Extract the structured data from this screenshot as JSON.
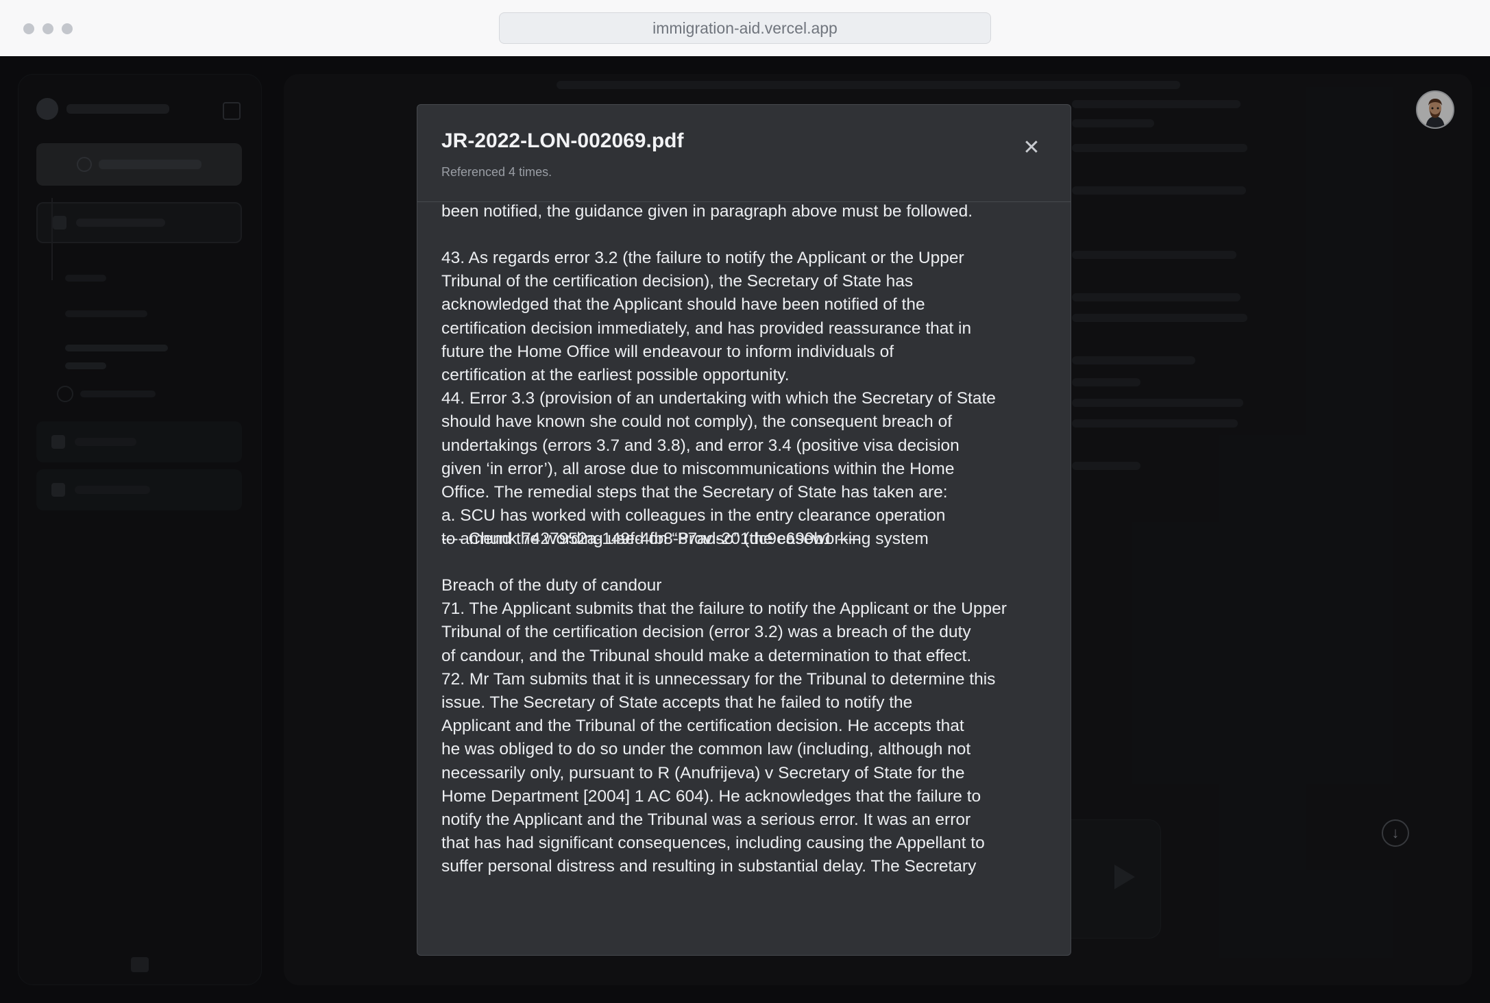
{
  "browser": {
    "url": "immigration-aid.vercel.app"
  },
  "modal": {
    "title": "JR-2022-LON-002069.pdf",
    "subtitle": "Referenced 4 times.",
    "close_icon": "close-icon",
    "paragraphs": [
      "been notified, the guidance given in paragraph above must be followed.",
      "43. As regards error 3.2 (the failure to notify the Applicant or the Upper\nTribunal of the certification decision), the Secretary of State has\nacknowledged that the Applicant should have been notified of the\ncertification decision immediately, and has provided reassurance that in\nfuture the Home Office will endeavour to inform individuals of\ncertification at the earliest possible opportunity.\n44. Error 3.3 (provision of an undertaking with which the Secretary of State\nshould have known she could not comply), the consequent breach of\nundertakings (errors 3.7 and 3.8), and error 3.4 (positive visa decision\ngiven ‘in error’), all arose due to miscommunications within the Home\nOffice. The remedial steps that the Secretary of State has taken are:\na. SCU has worked with colleagues in the entry clearance operation\nto amend the wording used on “Proviso” (the caseworking system",
      "---- Chunk 7427952a-149f-4fb8-87ad-201dc9e690b1 ----",
      "Breach of the duty of candour\n71. The Applicant submits that the failure to notify the Applicant or the Upper\nTribunal of the certification decision (error 3.2) was a breach of the duty\nof candour, and the Tribunal should make a determination to that effect.\n72. Mr Tam submits that it is unnecessary for the Tribunal to determine this\nissue. The Secretary of State accepts that he failed to notify the\nApplicant and the Tribunal of the certification decision. He accepts that\nhe was obliged to do so under the common law (including, although not\nnecessarily only, pursuant to R (Anufrijeva) v Secretary of State for the\nHome Department [2004] 1 AC 604). He acknowledges that the failure to\nnotify the Applicant and the Tribunal was a serious error. It was an error\nthat has had significant consequences, including causing the Appellant to\nsuffer personal distress and resulting in substantial delay. The Secretary"
    ]
  },
  "icons": {
    "scroll_down": "arrow-down-icon",
    "send": "send-icon",
    "avatar": "user-avatar"
  }
}
